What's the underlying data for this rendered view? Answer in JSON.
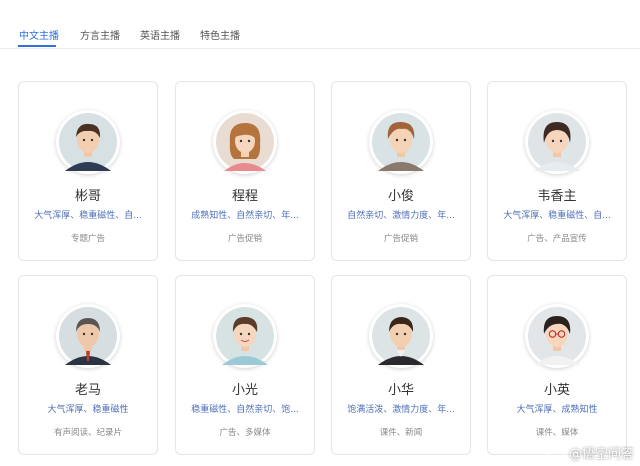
{
  "tabs": [
    {
      "label": "中文主播",
      "active": true
    },
    {
      "label": "方言主播",
      "active": false
    },
    {
      "label": "英语主播",
      "active": false
    },
    {
      "label": "特色主播",
      "active": false
    }
  ],
  "anchors": [
    {
      "name": "彬哥",
      "tags": "大气浑厚、稳重磁性、自...",
      "usage": "专题广告",
      "avatar_icon": "male-avatar-icon"
    },
    {
      "name": "程程",
      "tags": "成熟知性、自然亲切、年...",
      "usage": "广告促销",
      "avatar_icon": "female-avatar-icon"
    },
    {
      "name": "小俊",
      "tags": "自然亲切、激情力度、年...",
      "usage": "广告促销",
      "avatar_icon": "young-male-avatar-icon"
    },
    {
      "name": "韦香主",
      "tags": "大气浑厚、稳重磁性、自...",
      "usage": "广告、产品宣传",
      "avatar_icon": "male-avatar-icon"
    },
    {
      "name": "老马",
      "tags": "大气浑厚、稳重磁性",
      "usage": "有声阅读、纪录片",
      "avatar_icon": "older-male-avatar-icon"
    },
    {
      "name": "小光",
      "tags": "稳重磁性、自然亲切、饱...",
      "usage": "广告、多媒体",
      "avatar_icon": "young-male-avatar-icon"
    },
    {
      "name": "小华",
      "tags": "饱满活泼、激情力度、年...",
      "usage": "课件、新闻",
      "avatar_icon": "male-avatar-icon"
    },
    {
      "name": "小英",
      "tags": "大气浑厚、成熟知性",
      "usage": "课件、媒体",
      "avatar_icon": "female-glasses-avatar-icon"
    }
  ],
  "colors": {
    "accent": "#2f6fde",
    "tag_text": "#4f6fb8"
  },
  "watermark": {
    "text": "@悟空问答",
    "icon": "wukong-logo-icon"
  }
}
